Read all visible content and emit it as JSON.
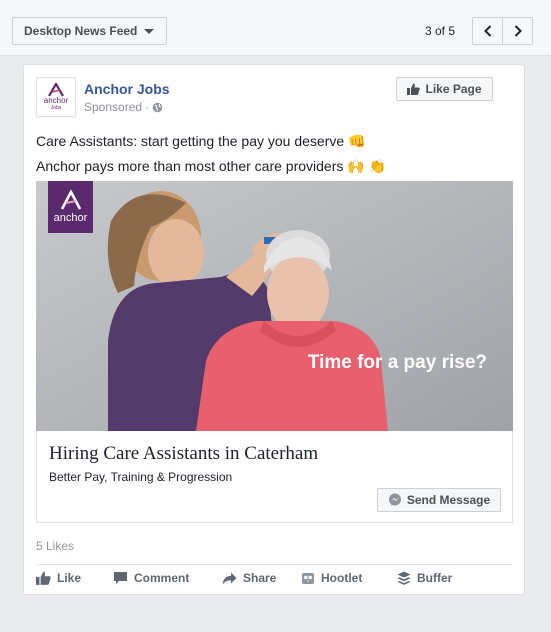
{
  "toolbar": {
    "placement_label": "Desktop News Feed",
    "pager_text": "3 of 5",
    "prev_icon": "chevron-left-icon",
    "next_icon": "chevron-right-icon"
  },
  "post": {
    "page_name": "Anchor Jobs",
    "sponsored_label": "Sponsored",
    "avatar_word": "anchor",
    "avatar_sub": "Jobs",
    "like_page_label": "Like Page",
    "text_lines": [
      "Care Assistants: start getting the pay you deserve 👊",
      "Anchor pays more than most other care providers 🙌 👏"
    ],
    "image": {
      "brand_word": "anchor",
      "overlay_text": "Time for a pay rise?"
    },
    "link": {
      "headline": "Hiring Care Assistants in Caterham",
      "description": "Better Pay, Training & Progression",
      "cta_label": "Send Message"
    },
    "likes_count": "5 Likes",
    "actions": {
      "like": "Like",
      "comment": "Comment",
      "share": "Share",
      "hootlet": "Hootlet",
      "buffer": "Buffer"
    }
  },
  "colors": {
    "brand_purple": "#5b2a6e",
    "link_blue": "#365899",
    "page_bg": "#e9ebee"
  }
}
